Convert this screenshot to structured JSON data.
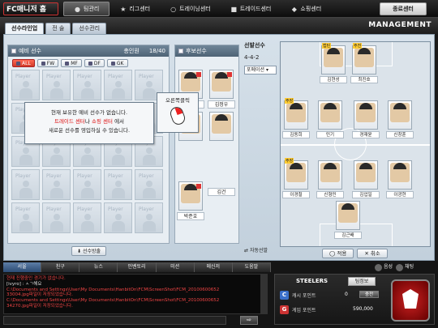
{
  "nav": {
    "logo": "FC매니저 홈",
    "items": [
      "팀관리",
      "리그센터",
      "트레이닝센터",
      "트레이드센터",
      "쇼핑센터"
    ],
    "logout": "종료센터"
  },
  "header": {
    "title": "MANAGEMENT",
    "tabs": [
      "선수라인업",
      "전 술",
      "선수관리"
    ]
  },
  "reserve": {
    "title": "예비 선수",
    "total_label": "총인원",
    "count": "18/40",
    "filters": [
      "ALL",
      "FW",
      "MF",
      "DF",
      "GK"
    ],
    "slot_label": "Player",
    "release_button": "선수방출"
  },
  "popup": {
    "line1": "현재 보유한 예비 선수가 없습니다.",
    "line2_em": "트레이드 센터",
    "line2_mid": "나",
    "line2_em2": "쇼핑 센터",
    "line2_tail": "에서",
    "line3": "새로운 선수를 영입하실 수 있습니다."
  },
  "callout": {
    "text": "오른쪽클릭"
  },
  "bench": {
    "title": "후보선수",
    "names": [
      "박상철",
      "김정우",
      "",
      "박준호"
    ],
    "extra_name": "김건"
  },
  "lineup": {
    "title": "선발선수",
    "formation": "4-4-2",
    "position_label": "포메이션",
    "auto_button": "자동선발",
    "apply_button": "적용",
    "cancel_button": "취소",
    "players": [
      {
        "name": "김현성",
        "tag": "캡틴"
      },
      {
        "name": "최진호",
        "tag": "주전"
      },
      {
        "name": "김동희",
        "tag": "주장"
      },
      {
        "name": "민기",
        "tag": ""
      },
      {
        "name": "경재윤",
        "tag": ""
      },
      {
        "name": "신창훈",
        "tag": ""
      },
      {
        "name": "이경철",
        "tag": "주장"
      },
      {
        "name": "신형민",
        "tag": ""
      },
      {
        "name": "김업일",
        "tag": ""
      },
      {
        "name": "이광현",
        "tag": ""
      },
      {
        "name": "김근배",
        "tag": ""
      }
    ]
  },
  "chat": {
    "tabs": [
      "서울",
      "친구",
      "뉴스",
      "인벤토리",
      "미션",
      "메신저",
      "도움말"
    ],
    "lines": [
      "현재 진행중인 경기가 없습니다.",
      "[ivyro] : ㅅㄱ해요",
      "C:\\Documents and Settings\\User\\My Documents\\HanbitOn\\FCM\\ScreenShot\\FCM_20100600652",
      "33004.jpg파일이 저장되었습니다.",
      "C:\\Documents and Settings\\User\\My Documents\\HanbitOn\\FCM\\ScreenShot\\FCM_20100600652",
      "34270.jpg파일이 저장되었습니다."
    ],
    "right_buttons": [
      "음성",
      "채팅"
    ]
  },
  "club": {
    "name": "STEELERS",
    "info_button": "팀정보",
    "cash_label": "캐시 포인트",
    "cash_value": "0",
    "charge_button": "충전",
    "game_label": "게임 포인트",
    "game_value": "590,000"
  },
  "colors": {
    "accent": "#d23a28",
    "panel_header": "#4e6375"
  }
}
